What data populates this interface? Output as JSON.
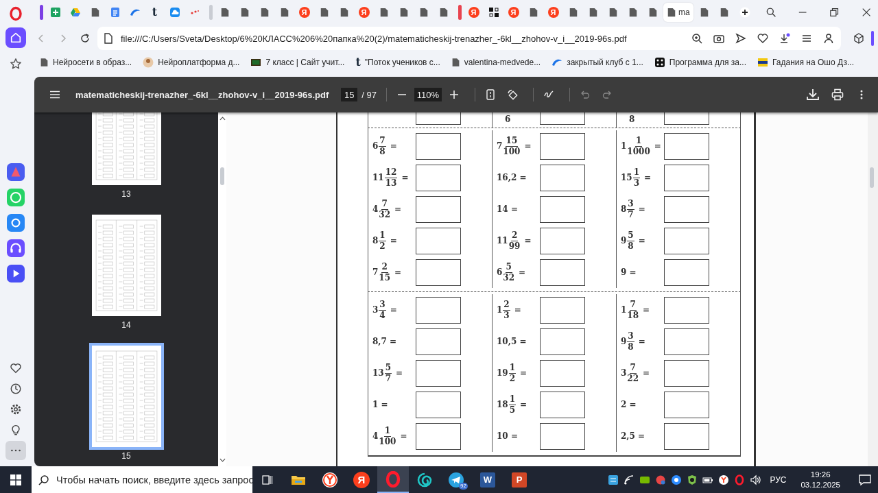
{
  "opera_sidebar": {
    "items": [
      {
        "kind": "home",
        "selected": true
      },
      {
        "kind": "star",
        "selected": false
      }
    ],
    "apps": [
      {
        "kind": "aria"
      },
      {
        "kind": "whatsapp"
      },
      {
        "kind": "vk"
      },
      {
        "kind": "music"
      },
      {
        "kind": "player"
      }
    ],
    "bottom": [
      {
        "kind": "heart"
      },
      {
        "kind": "history"
      },
      {
        "kind": "settings"
      },
      {
        "kind": "bulb"
      },
      {
        "kind": "more"
      }
    ]
  },
  "tabs": [
    {
      "kind": "sheets",
      "selected": false,
      "color": "#7b3fe4"
    },
    {
      "kind": "drive",
      "selected": false
    },
    {
      "kind": "doc",
      "selected": false
    },
    {
      "kind": "docs",
      "selected": false
    },
    {
      "kind": "swoosh",
      "selected": false
    },
    {
      "kind": "letter",
      "glyph": "t",
      "selected": false
    },
    {
      "kind": "cloud",
      "selected": false
    },
    {
      "kind": "dots",
      "selected": false
    },
    {
      "kind": "doc",
      "selected": false,
      "color": "#c9ccd3"
    },
    {
      "kind": "doc",
      "selected": false
    },
    {
      "kind": "doc",
      "selected": false
    },
    {
      "kind": "doc",
      "selected": false
    },
    {
      "kind": "yandex",
      "glyph": "Я",
      "selected": false
    },
    {
      "kind": "doc",
      "selected": false
    },
    {
      "kind": "doc",
      "selected": false
    },
    {
      "kind": "yandex",
      "glyph": "Я",
      "selected": false
    },
    {
      "kind": "doc",
      "selected": false
    },
    {
      "kind": "doc",
      "selected": false
    },
    {
      "kind": "doc",
      "selected": false
    },
    {
      "kind": "doc",
      "selected": false
    },
    {
      "kind": "yandex",
      "glyph": "Я",
      "selected": false,
      "color": "#e8434f"
    },
    {
      "kind": "grid",
      "selected": false
    },
    {
      "kind": "yandex",
      "glyph": "Я",
      "selected": false
    },
    {
      "kind": "doc",
      "selected": false
    },
    {
      "kind": "yandex",
      "glyph": "Я",
      "selected": false
    },
    {
      "kind": "doc",
      "selected": false
    },
    {
      "kind": "doc",
      "selected": false
    },
    {
      "kind": "doc",
      "selected": false
    },
    {
      "kind": "doc",
      "selected": false
    },
    {
      "kind": "doc",
      "selected": false
    },
    {
      "kind": "doc",
      "label": "ma",
      "selected": true
    },
    {
      "kind": "doc",
      "selected": false
    },
    {
      "kind": "doc",
      "selected": false
    }
  ],
  "address": "file:///C:/Users/Sveta/Desktop/6%20КЛАСС%206%20папка%20(2)/matematicheskij-trenazher_-6kl__zhohov-v_i__2019-96s.pdf",
  "bookmarks": [
    {
      "kind": "doc",
      "label": "Нейросети в образ..."
    },
    {
      "kind": "avatar",
      "label": "Нейроплатформа д..."
    },
    {
      "kind": "board",
      "label": "7 класс | Сайт учит..."
    },
    {
      "kind": "letter",
      "glyph": "t",
      "label": "\"Поток учеников с..."
    },
    {
      "kind": "doc",
      "label": "valentina-medvede..."
    },
    {
      "kind": "swoosh",
      "label": "закрытый клуб с 1..."
    },
    {
      "kind": "dice",
      "label": "Программа для за..."
    },
    {
      "kind": "flag",
      "label": "Гадания на Ошо Дз..."
    }
  ],
  "pdf": {
    "title": "matematicheskij-trenazher_-6kl__zhohov-v_i__2019-96s.pdf",
    "page": "15",
    "page_count": "/ 97",
    "zoom": "110%",
    "thumbnails": [
      {
        "label": "13",
        "selected": false
      },
      {
        "label": "14",
        "selected": false
      },
      {
        "label": "15",
        "selected": true
      }
    ],
    "sections": [
      {
        "rows": [
          [
            {
              "kind": "cut"
            },
            {
              "kind": "cut",
              "text": "6"
            },
            {
              "kind": "cut",
              "text": "8"
            }
          ]
        ]
      },
      {
        "rows": [
          [
            {
              "kind": "fraction",
              "whole": "6",
              "num": "7",
              "den": "8",
              "sign": "="
            },
            {
              "kind": "fraction",
              "whole": "7",
              "num": "15",
              "den": "100",
              "sign": "="
            },
            {
              "kind": "fraction",
              "whole": "1",
              "num": "1",
              "den": "1000",
              "sign": "="
            }
          ],
          [
            {
              "kind": "fraction",
              "whole": "11",
              "num": "12",
              "den": "13",
              "sign": "="
            },
            {
              "kind": "plain",
              "text": "16,2 ="
            },
            {
              "kind": "fraction",
              "whole": "15",
              "num": "1",
              "den": "3",
              "sign": "="
            }
          ],
          [
            {
              "kind": "fraction",
              "whole": "4",
              "num": "7",
              "den": "32",
              "sign": "="
            },
            {
              "kind": "plain",
              "text": "14 ="
            },
            {
              "kind": "fraction",
              "whole": "8",
              "num": "3",
              "den": "7",
              "sign": "="
            }
          ],
          [
            {
              "kind": "fraction",
              "whole": "8",
              "num": "1",
              "den": "2",
              "sign": "="
            },
            {
              "kind": "fraction",
              "whole": "11",
              "num": "2",
              "den": "99",
              "sign": "="
            },
            {
              "kind": "fraction",
              "whole": "9",
              "num": "5",
              "den": "8",
              "sign": "="
            }
          ],
          [
            {
              "kind": "fraction",
              "whole": "7",
              "num": "2",
              "den": "15",
              "sign": "="
            },
            {
              "kind": "fraction",
              "whole": "6",
              "num": "5",
              "den": "32",
              "sign": "="
            },
            {
              "kind": "plain",
              "text": "9 ="
            }
          ]
        ]
      },
      {
        "rows": [
          [
            {
              "kind": "fraction",
              "whole": "3",
              "num": "3",
              "den": "4",
              "sign": "="
            },
            {
              "kind": "fraction",
              "whole": "1",
              "num": "2",
              "den": "3",
              "sign": "="
            },
            {
              "kind": "fraction",
              "whole": "1",
              "num": "7",
              "den": "18",
              "sign": "="
            }
          ],
          [
            {
              "kind": "plain",
              "text": "8,7 ="
            },
            {
              "kind": "plain",
              "text": "10,5 ="
            },
            {
              "kind": "fraction",
              "whole": "9",
              "num": "3",
              "den": "8",
              "sign": "="
            }
          ],
          [
            {
              "kind": "fraction",
              "whole": "13",
              "num": "5",
              "den": "7",
              "sign": "="
            },
            {
              "kind": "fraction",
              "whole": "19",
              "num": "1",
              "den": "2",
              "sign": "="
            },
            {
              "kind": "fraction",
              "whole": "3",
              "num": "7",
              "den": "22",
              "sign": "="
            }
          ],
          [
            {
              "kind": "plain",
              "text": "1 ="
            },
            {
              "kind": "fraction",
              "whole": "18",
              "num": "1",
              "den": "5",
              "sign": "="
            },
            {
              "kind": "plain",
              "text": "2 ="
            }
          ],
          [
            {
              "kind": "fraction",
              "whole": "4",
              "num": "1",
              "den": "100",
              "sign": "="
            },
            {
              "kind": "plain",
              "text": "10 ="
            },
            {
              "kind": "plain",
              "text": "2,5 ="
            }
          ]
        ]
      }
    ]
  },
  "taskbar": {
    "search_placeholder": "Чтобы начать поиск, введите здесь запрос",
    "apps": [
      {
        "kind": "explorer",
        "selected": false
      },
      {
        "kind": "yabrowser",
        "selected": false
      },
      {
        "kind": "yandex",
        "glyph": "Я",
        "selected": false
      },
      {
        "kind": "opera",
        "selected": true
      },
      {
        "kind": "spiral",
        "selected": false
      },
      {
        "kind": "telegram",
        "badge": "92",
        "selected": false
      },
      {
        "kind": "word",
        "glyph": "W",
        "selected": false
      },
      {
        "kind": "powerpoint",
        "glyph": "P",
        "selected": false
      }
    ],
    "language": "РУС",
    "time": "19:26",
    "date": "03.12.2025"
  }
}
